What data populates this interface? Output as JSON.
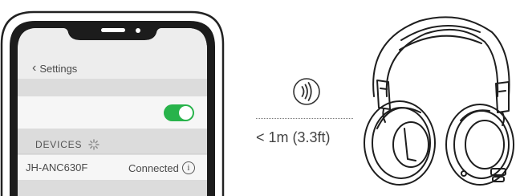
{
  "phone": {
    "back_label": "Settings",
    "devices_label": "DEVICES",
    "device_name": "JH-ANC630F",
    "device_status": "Connected",
    "info_glyph": "i",
    "toggle_state": "on",
    "toggle_color": "#28b34b"
  },
  "distance_text": "< 1m (3.3ft)",
  "icons": {
    "nfc": "nfc-icon",
    "loading": "loading-spinner-icon",
    "back": "chevron-left-icon",
    "info": "info-icon"
  }
}
